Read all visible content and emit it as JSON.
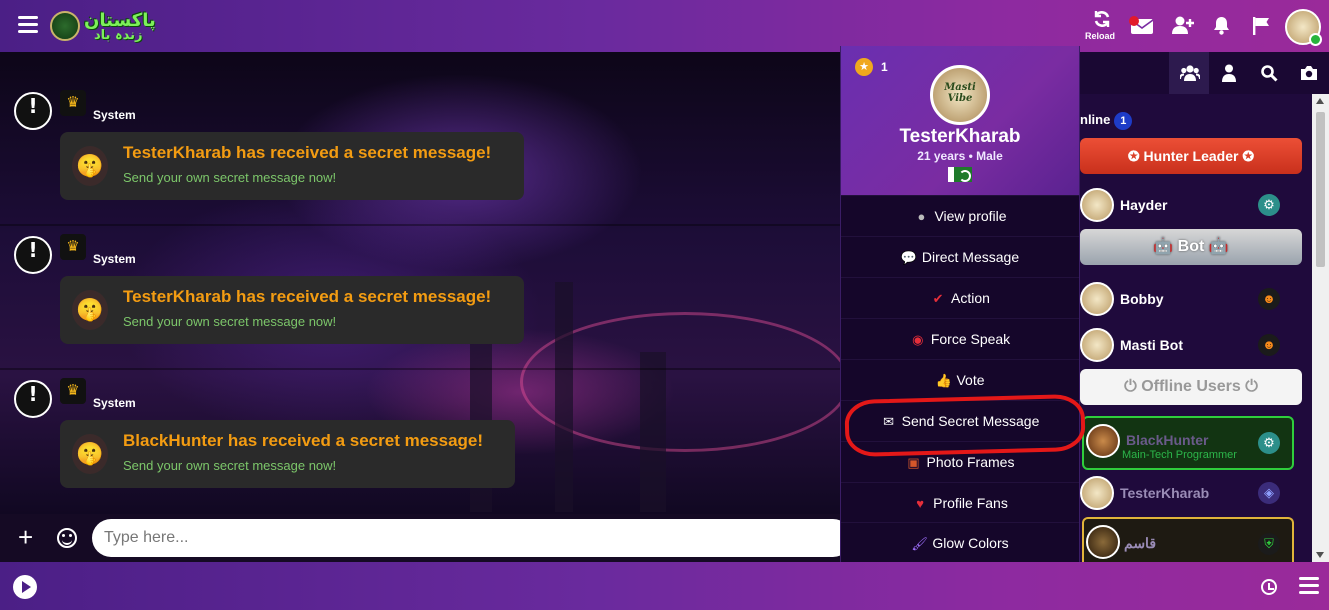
{
  "header": {
    "logo_text": "پاکستان",
    "logo_sub": "زندہ باد",
    "reload_label": "Reload"
  },
  "messages": [
    {
      "sender": "System",
      "headline": "TesterKharab has received a secret message!",
      "subline": "Send your own secret message now!"
    },
    {
      "sender": "System",
      "headline": "TesterKharab has received a secret message!",
      "subline": "Send your own secret message now!"
    },
    {
      "sender": "System",
      "headline": "BlackHunter has received a secret message!",
      "subline": "Send your own secret message now!"
    }
  ],
  "input": {
    "placeholder": "Type here..."
  },
  "profile_popup": {
    "level": "1",
    "avatar_text": "Masti Vibe",
    "name": "TesterKharab",
    "age_gender": "21 years • Male",
    "menu": [
      {
        "label": "View profile",
        "icon": "user-circle-icon"
      },
      {
        "label": "Direct Message",
        "icon": "chat-bubbles-icon"
      },
      {
        "label": "Action",
        "icon": "check-icon"
      },
      {
        "label": "Force Speak",
        "icon": "force-speak-icon"
      },
      {
        "label": "Vote",
        "icon": "thumbs-up-icon"
      },
      {
        "label": "Send Secret Message",
        "icon": "envelope-icon"
      },
      {
        "label": "Photo Frames",
        "icon": "frame-icon"
      },
      {
        "label": "Profile Fans",
        "icon": "heart-icon"
      },
      {
        "label": "Glow Colors",
        "icon": "brush-icon"
      }
    ]
  },
  "sidebar": {
    "online_label": "nline",
    "online_count": "1",
    "hunter_leader_label": "Hunter Leader",
    "bot_label": "Bot",
    "offline_label": "Offline Users",
    "users_online": [
      {
        "name": "Hayder"
      }
    ],
    "bots": [
      {
        "name": "Bobby"
      },
      {
        "name": "Masti Bot"
      }
    ],
    "users_offline": [
      {
        "name": "BlackHunter",
        "subtitle": "Main-Tech Programmer"
      },
      {
        "name": "TesterKharab"
      },
      {
        "name": "قاسم"
      }
    ]
  },
  "colors": {
    "accent_purple": "#7a2ca2",
    "headline_orange": "#f39c12",
    "subline_green": "#7cc66a",
    "hunter_red": "#e53f2b",
    "highlight_red": "#e41818"
  }
}
